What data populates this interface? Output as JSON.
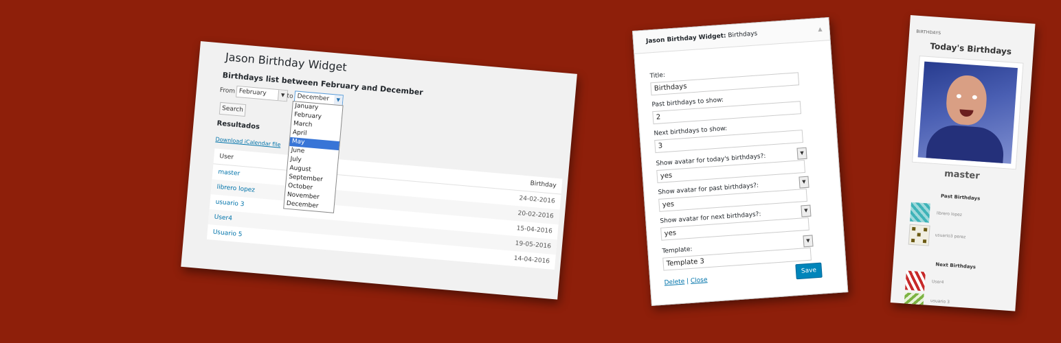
{
  "admin": {
    "title": "Jason Birthday Widget",
    "subtitle": "Birthdays list between February and December",
    "from_label": "From",
    "from_value": "February",
    "to_label": "to",
    "to_value": "December",
    "months": [
      "January",
      "February",
      "March",
      "April",
      "May",
      "June",
      "July",
      "August",
      "September",
      "October",
      "November",
      "December"
    ],
    "highlighted_month": "May",
    "search_label": "Search",
    "results_label": "Resultados",
    "download_label": "Download iCalendar file",
    "columns": {
      "user": "User",
      "birthday": "Birthday"
    },
    "rows": [
      {
        "user": "master",
        "birthday": "24-02-2016"
      },
      {
        "user": "librero lopez",
        "birthday": "20-02-2016"
      },
      {
        "user": "usuario 3",
        "birthday": "15-04-2016"
      },
      {
        "user": "User4",
        "birthday": "19-05-2016"
      },
      {
        "user": "Usuario 5",
        "birthday": "14-04-2016"
      }
    ]
  },
  "widget_form": {
    "header_bold": "Jason Birthday Widget:",
    "header_rest": " Birthdays",
    "toggle_icon": "triangle-up",
    "title_label": "Title:",
    "title_value": "Birthdays",
    "past_label": "Past birthdays to show:",
    "past_value": "2",
    "next_label": "Next birthdays to show:",
    "next_value": "3",
    "avatar_today_label": "Show avatar for today's birthdays?:",
    "avatar_today_value": "yes",
    "avatar_past_label": "Show avatar for past birthdays?:",
    "avatar_past_value": "yes",
    "avatar_next_label": "Show avatar for next birthdays?:",
    "avatar_next_value": "yes",
    "template_label": "Template:",
    "template_value": "Template 3",
    "delete_label": "Delete",
    "separator": " | ",
    "close_label": "Close",
    "save_label": "Save",
    "save_color": "#0085ba"
  },
  "front_widget": {
    "caption": "BIRTHDAYS",
    "heading": "Today's Birthdays",
    "today_name": "master",
    "past_heading": "Past Birthdays",
    "past_users": [
      "librero lopez",
      "usuario3 perez"
    ],
    "next_heading": "Next Birthdays",
    "next_users": [
      "User4",
      "usuario 3"
    ]
  },
  "colors": {
    "background": "#8e1f0a",
    "link": "#0073aa"
  }
}
